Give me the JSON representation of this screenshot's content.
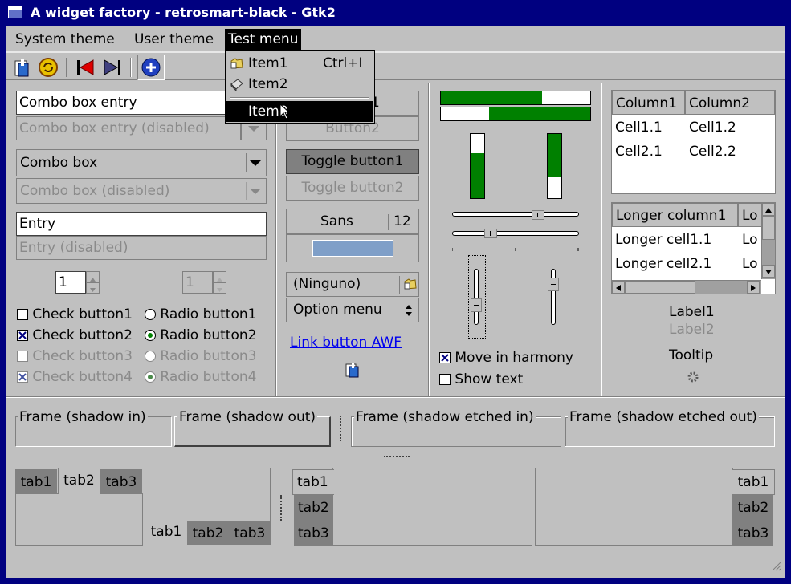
{
  "window": {
    "title": "A widget factory - retrosmart-black - Gtk2"
  },
  "menubar": [
    {
      "label": "System theme"
    },
    {
      "label": "User theme"
    },
    {
      "label": "Test menu"
    }
  ],
  "test_menu": {
    "items": [
      {
        "label": "Item1",
        "accel": "Ctrl+I"
      },
      {
        "label": "Item2",
        "accel": ""
      },
      {
        "label": "Item3",
        "accel": ""
      }
    ]
  },
  "toolbar": {
    "icons": [
      "open-file-icon",
      "refresh-icon",
      "previous-icon",
      "next-icon",
      "add-icon"
    ]
  },
  "col1": {
    "combo_entry": "Combo box entry",
    "combo_entry_disabled": "Combo box entry (disabled)",
    "combo_box": "Combo box",
    "combo_box_disabled": "Combo box (disabled)",
    "entry": "Entry",
    "entry_disabled": "Entry (disabled)",
    "spin1": "1",
    "spin2": "1",
    "checks": [
      "Check button1",
      "Check button2",
      "Check button3",
      "Check button4"
    ],
    "radios": [
      "Radio button1",
      "Radio button2",
      "Radio button3",
      "Radio button4"
    ]
  },
  "col2": {
    "button1": "Button1",
    "button2": "Button2",
    "toggle1": "Toggle button1",
    "toggle2": "Toggle button2",
    "font_name": "Sans",
    "font_size": "12",
    "color_hex": "#7f9fc8",
    "file_chooser": "(Ninguno)",
    "option_menu": "Option menu",
    "link": "Link button AWF"
  },
  "col3": {
    "progress_h1": 0.68,
    "progress_h2": 0.32,
    "progress_v1": 0.7,
    "progress_v2": 0.33,
    "move_in_harmony": "Move in harmony",
    "show_text": "Show text"
  },
  "col4": {
    "tree1": {
      "headers": [
        "Column1",
        "Column2"
      ],
      "rows": [
        [
          "Cell1.1",
          "Cell1.2"
        ],
        [
          "Cell2.1",
          "Cell2.2"
        ]
      ]
    },
    "tree2": {
      "headers": [
        "Longer column1",
        "Lo"
      ],
      "rows": [
        [
          "Longer cell1.1",
          "Lo"
        ],
        [
          "Longer cell2.1",
          "Lo"
        ]
      ]
    },
    "label1": "Label1",
    "label2": "Label2",
    "tooltip": "Tooltip"
  },
  "frames": [
    "Frame (shadow in)",
    "Frame (shadow out)",
    "Frame (shadow etched in)",
    "Frame (shadow etched out)"
  ],
  "tabs": [
    "tab1",
    "tab2",
    "tab3"
  ],
  "colors": {
    "title_bg": "#000080",
    "window_bg": "#c0c0c0",
    "progress_fill": "#008000",
    "link": "#0000ee",
    "menu_selected": "#000000"
  }
}
